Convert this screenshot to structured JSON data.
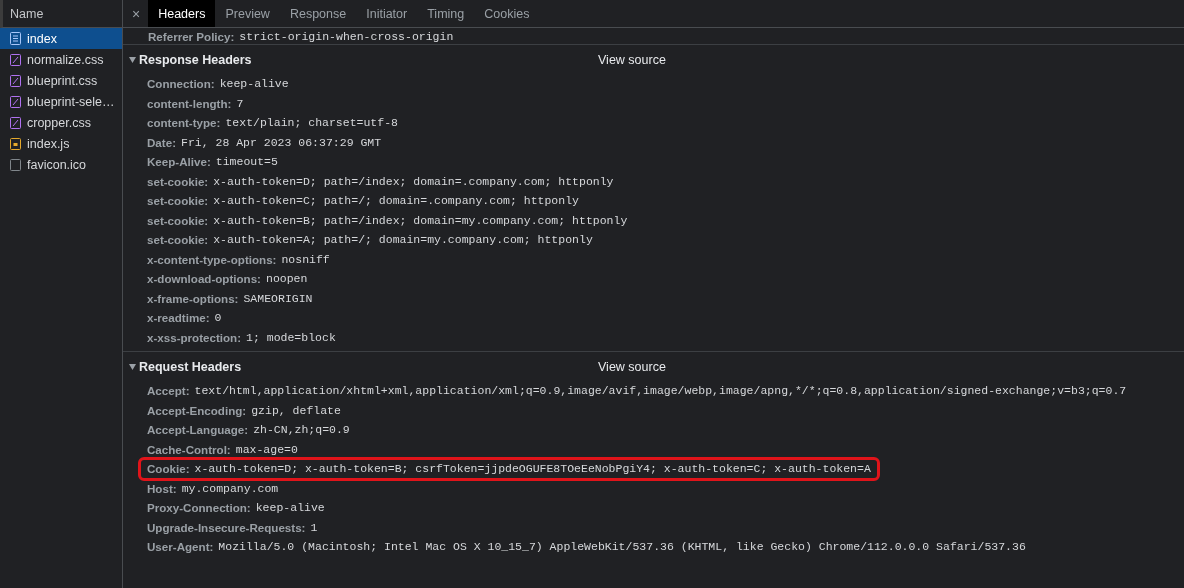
{
  "sidebar": {
    "header": "Name",
    "items": [
      {
        "label": "index",
        "kind": "document",
        "selected": true
      },
      {
        "label": "normalize.css",
        "kind": "stylesheet",
        "selected": false
      },
      {
        "label": "blueprint.css",
        "kind": "stylesheet",
        "selected": false
      },
      {
        "label": "blueprint-sele…",
        "kind": "stylesheet",
        "selected": false
      },
      {
        "label": "cropper.css",
        "kind": "stylesheet",
        "selected": false
      },
      {
        "label": "index.js",
        "kind": "script",
        "selected": false
      },
      {
        "label": "favicon.ico",
        "kind": "other",
        "selected": false
      }
    ]
  },
  "tabs": {
    "close": "×",
    "items": [
      {
        "label": "Headers",
        "selected": true
      },
      {
        "label": "Preview",
        "selected": false
      },
      {
        "label": "Response",
        "selected": false
      },
      {
        "label": "Initiator",
        "selected": false
      },
      {
        "label": "Timing",
        "selected": false
      },
      {
        "label": "Cookies",
        "selected": false
      }
    ]
  },
  "top_line": {
    "name": "Referrer Policy:",
    "value": "strict-origin-when-cross-origin"
  },
  "sections": [
    {
      "title": "Response Headers",
      "expanded": true,
      "view_source": "View source",
      "headers": [
        {
          "name": "Connection:",
          "value": "keep-alive",
          "highlighted": false
        },
        {
          "name": "content-length:",
          "value": "7",
          "highlighted": false
        },
        {
          "name": "content-type:",
          "value": "text/plain; charset=utf-8",
          "highlighted": false
        },
        {
          "name": "Date:",
          "value": "Fri, 28 Apr 2023 06:37:29 GMT",
          "highlighted": false
        },
        {
          "name": "Keep-Alive:",
          "value": "timeout=5",
          "highlighted": false
        },
        {
          "name": "set-cookie:",
          "value": "x-auth-token=D; path=/index; domain=.company.com; httponly",
          "highlighted": false
        },
        {
          "name": "set-cookie:",
          "value": "x-auth-token=C; path=/; domain=.company.com; httponly",
          "highlighted": false
        },
        {
          "name": "set-cookie:",
          "value": "x-auth-token=B; path=/index; domain=my.company.com; httponly",
          "highlighted": false
        },
        {
          "name": "set-cookie:",
          "value": "x-auth-token=A; path=/; domain=my.company.com; httponly",
          "highlighted": false
        },
        {
          "name": "x-content-type-options:",
          "value": "nosniff",
          "highlighted": false
        },
        {
          "name": "x-download-options:",
          "value": "noopen",
          "highlighted": false
        },
        {
          "name": "x-frame-options:",
          "value": "SAMEORIGIN",
          "highlighted": false
        },
        {
          "name": "x-readtime:",
          "value": "0",
          "highlighted": false
        },
        {
          "name": "x-xss-protection:",
          "value": "1; mode=block",
          "highlighted": false
        }
      ]
    },
    {
      "title": "Request Headers",
      "expanded": true,
      "view_source": "View source",
      "headers": [
        {
          "name": "Accept:",
          "value": "text/html,application/xhtml+xml,application/xml;q=0.9,image/avif,image/webp,image/apng,*/*;q=0.8,application/signed-exchange;v=b3;q=0.7",
          "highlighted": false
        },
        {
          "name": "Accept-Encoding:",
          "value": "gzip, deflate",
          "highlighted": false
        },
        {
          "name": "Accept-Language:",
          "value": "zh-CN,zh;q=0.9",
          "highlighted": false
        },
        {
          "name": "Cache-Control:",
          "value": "max-age=0",
          "highlighted": false
        },
        {
          "name": "Cookie:",
          "value": "x-auth-token=D; x-auth-token=B; csrfToken=jjpdeOGUFE8TOeEeNobPgiY4; x-auth-token=C; x-auth-token=A",
          "highlighted": true
        },
        {
          "name": "Host:",
          "value": "my.company.com",
          "highlighted": false
        },
        {
          "name": "Proxy-Connection:",
          "value": "keep-alive",
          "highlighted": false
        },
        {
          "name": "Upgrade-Insecure-Requests:",
          "value": "1",
          "highlighted": false
        },
        {
          "name": "User-Agent:",
          "value": "Mozilla/5.0 (Macintosh; Intel Mac OS X 10_15_7) AppleWebKit/537.36 (KHTML, like Gecko) Chrome/112.0.0.0 Safari/537.36",
          "highlighted": false
        }
      ]
    }
  ]
}
